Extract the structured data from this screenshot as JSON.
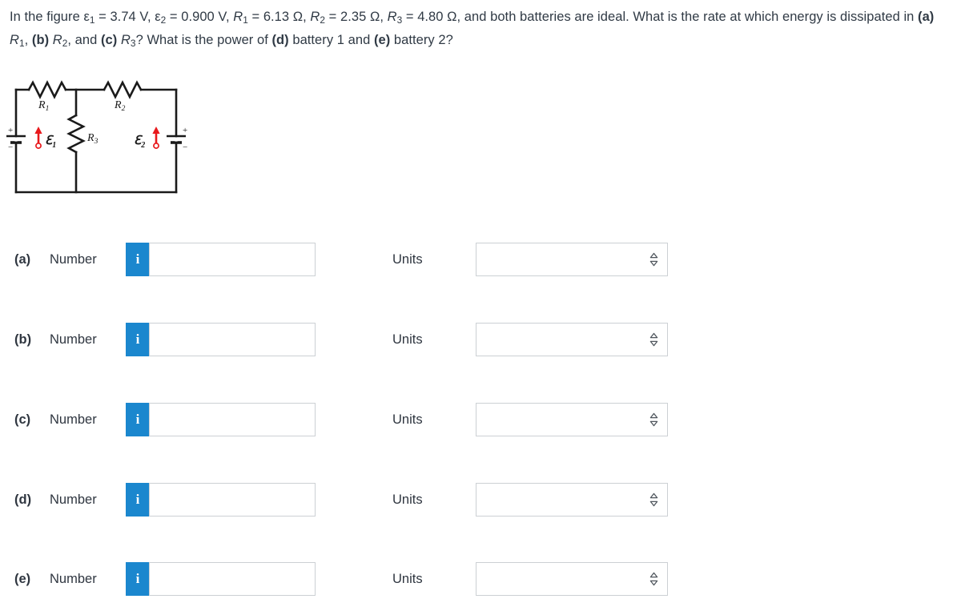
{
  "question": {
    "line1_parts": [
      {
        "t": "In the figure "
      },
      {
        "t": "ε",
        "sub": "1"
      },
      {
        "t": " = 3.74 V, "
      },
      {
        "t": "ε",
        "sub": "2"
      },
      {
        "t": " = 0.900 V, "
      },
      {
        "t": "R",
        "sub": "1",
        "italic": true
      },
      {
        "t": " = 6.13 Ω, "
      },
      {
        "t": "R",
        "sub": "2",
        "italic": true
      },
      {
        "t": " = 2.35 Ω, "
      },
      {
        "t": "R",
        "sub": "3",
        "italic": true
      },
      {
        "t": " = 4.80 Ω, and both batteries are ideal. What is the rate at which energy is dissipated in "
      },
      {
        "t": "(a)",
        "bold": true
      },
      {
        "t": " "
      },
      {
        "t": "R",
        "sub": "1",
        "italic": true
      },
      {
        "t": ", "
      },
      {
        "t": "(b)",
        "bold": true
      },
      {
        "t": " "
      },
      {
        "t": "R",
        "sub": "2",
        "italic": true
      },
      {
        "t": ", and "
      },
      {
        "t": "(c)",
        "bold": true
      },
      {
        "t": " "
      },
      {
        "t": "R",
        "sub": "3",
        "italic": true
      },
      {
        "t": "? What is the power of "
      },
      {
        "t": "(d)",
        "bold": true
      },
      {
        "t": " battery 1 and "
      },
      {
        "t": "(e)",
        "bold": true
      },
      {
        "t": " battery 2?"
      }
    ],
    "full_text": "In the figure ε1 = 3.74 V, ε2 = 0.900 V, R1 = 6.13 Ω, R2 = 2.35 Ω, R3 = 4.80 Ω, and both batteries are ideal. What is the rate at which energy is dissipated in (a) R1, (b) R2, and (c) R3? What is the power of (d) battery 1 and (e) battery 2?",
    "values": {
      "emf1": "3.74 V",
      "emf2": "0.900 V",
      "R1": "6.13 Ω",
      "R2": "2.35 Ω",
      "R3": "4.80 Ω"
    }
  },
  "figure": {
    "name": "circuit-diagram",
    "labels": {
      "R1": "R₁",
      "R2": "R₂",
      "R3": "R₃",
      "emf1": "ℰ₁",
      "emf2": "ℰ₂",
      "plus_left": "+",
      "minus_left": "−",
      "plus_right": "+",
      "minus_right": "−"
    },
    "colors": {
      "wire": "#1a1a1a",
      "arrow": "#e8191c"
    }
  },
  "rows": [
    {
      "letter": "(a)",
      "number_label": "Number",
      "info_icon": "i",
      "number_value": "",
      "number_placeholder": "",
      "units_label": "Units",
      "units_value": "",
      "units_placeholder": ""
    },
    {
      "letter": "(b)",
      "number_label": "Number",
      "info_icon": "i",
      "number_value": "",
      "number_placeholder": "",
      "units_label": "Units",
      "units_value": "",
      "units_placeholder": ""
    },
    {
      "letter": "(c)",
      "number_label": "Number",
      "info_icon": "i",
      "number_value": "",
      "number_placeholder": "",
      "units_label": "Units",
      "units_value": "",
      "units_placeholder": ""
    },
    {
      "letter": "(d)",
      "number_label": "Number",
      "info_icon": "i",
      "number_value": "",
      "number_placeholder": "",
      "units_label": "Units",
      "units_value": "",
      "units_placeholder": ""
    },
    {
      "letter": "(e)",
      "number_label": "Number",
      "info_icon": "i",
      "number_value": "",
      "number_placeholder": "",
      "units_label": "Units",
      "units_value": "",
      "units_placeholder": ""
    }
  ],
  "theme": {
    "accent_blue": "#1b87ce",
    "border_gray": "#ccd0d4",
    "text": "#2f3640",
    "arrow_red": "#e8191c"
  }
}
